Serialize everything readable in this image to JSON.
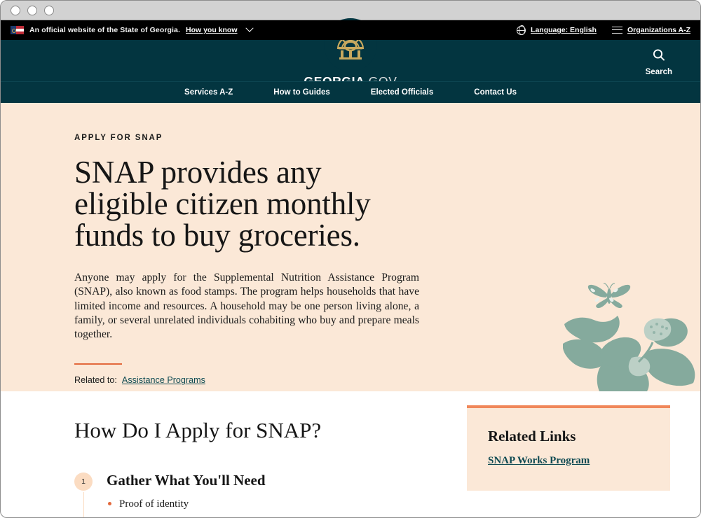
{
  "window": {
    "buttons": [
      "close",
      "minimize",
      "maximize"
    ]
  },
  "utility_bar": {
    "official_text": "An official website of the State of Georgia.",
    "how_you_know": "How you know",
    "flag_icon": "georgia-state-flag-icon",
    "chevron_icon": "chevron-down-icon",
    "language": {
      "icon": "globe-icon",
      "label": "Language: English"
    },
    "organizations": {
      "icon": "list-icon",
      "label": "Organizations A-Z"
    }
  },
  "masthead": {
    "logo_icon": "georgia-capitol-arch-icon",
    "brand_bold": "GEORGIA",
    "brand_light": ".GOV",
    "search": {
      "icon": "search-icon",
      "label": "Search"
    }
  },
  "nav": {
    "items": [
      {
        "label": "Services A-Z"
      },
      {
        "label": "How to Guides"
      },
      {
        "label": "Elected Officials"
      },
      {
        "label": "Contact Us"
      }
    ]
  },
  "hero": {
    "eyebrow": "APPLY FOR SNAP",
    "headline": "SNAP provides any eligible citizen monthly funds to buy groceries.",
    "body": "Anyone may apply for the Supplemental Nutrition Assistance Program (SNAP), also known as food stamps. The program helps households that have limited income and resources. A household may be one person living alone, a family, or several unrelated individuals cohabiting who buy and prepare meals together.",
    "related_label": "Related to:",
    "related_link": "Assistance Programs",
    "illustration": "oak-leaves-acorns-butterfly-illustration"
  },
  "main": {
    "heading": "How Do I Apply for SNAP?",
    "steps": [
      {
        "number": "1",
        "title": "Gather What You'll Need",
        "bullets": [
          "Proof of identity"
        ]
      }
    ]
  },
  "sidebar": {
    "card": {
      "title": "Related Links",
      "links": [
        {
          "label": "SNAP Works Program"
        }
      ]
    }
  },
  "colors": {
    "header_teal": "#033540",
    "hero_peach": "#fbe8d7",
    "accent_orange": "#e3693c",
    "card_border_orange": "#f0875a",
    "link_teal": "#0f4a52",
    "logo_gold": "#c8a95e"
  }
}
